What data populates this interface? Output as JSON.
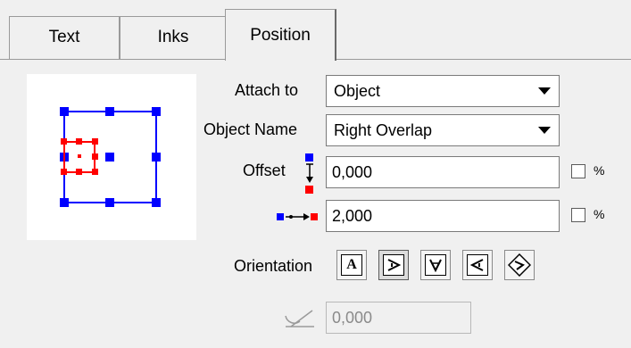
{
  "tabs": [
    {
      "label": "Text"
    },
    {
      "label": "Inks"
    },
    {
      "label": "Position"
    }
  ],
  "attach_to": {
    "label": "Attach to",
    "value": "Object"
  },
  "object_name": {
    "label": "Object Name",
    "value": "Right Overlap"
  },
  "offset": {
    "label": "Offset",
    "value": "0,000",
    "percent_label": "%"
  },
  "offset2": {
    "value": "2,000",
    "percent_label": "%"
  },
  "orientation": {
    "label": "Orientation"
  },
  "angle": {
    "value": "0,000"
  },
  "colors": {
    "blue": "#0000ff",
    "red": "#ff0000"
  }
}
